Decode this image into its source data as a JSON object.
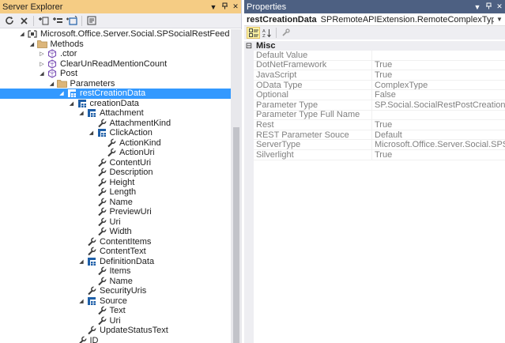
{
  "server_explorer": {
    "title": "Server Explorer",
    "tree": [
      {
        "label": "Microsoft.Office.Server.Social.SPSocialRestFeed",
        "icon": "namespace-icon",
        "depth": 2,
        "expander": "expanded"
      },
      {
        "label": "Methods",
        "icon": "folder-icon",
        "depth": 3,
        "expander": "expanded"
      },
      {
        "label": ".ctor",
        "icon": "method-icon",
        "depth": 4,
        "expander": "collapsed"
      },
      {
        "label": "ClearUnReadMentionCount",
        "icon": "method-icon",
        "depth": 4,
        "expander": "collapsed"
      },
      {
        "label": "Post",
        "icon": "method-icon",
        "depth": 4,
        "expander": "expanded"
      },
      {
        "label": "Parameters",
        "icon": "folder-icon",
        "depth": 5,
        "expander": "expanded"
      },
      {
        "label": "restCreationData",
        "icon": "complex-type-icon",
        "depth": 6,
        "expander": "expanded",
        "selected": true
      },
      {
        "label": "creationData",
        "icon": "complex-type-icon",
        "depth": 7,
        "expander": "expanded"
      },
      {
        "label": "Attachment",
        "icon": "complex-type-icon",
        "depth": 8,
        "expander": "expanded"
      },
      {
        "label": "AttachmentKind",
        "icon": "property-wrench-icon",
        "depth": 9,
        "expander": "none"
      },
      {
        "label": "ClickAction",
        "icon": "complex-type-icon",
        "depth": 9,
        "expander": "expanded"
      },
      {
        "label": "ActionKind",
        "icon": "property-wrench-icon",
        "depth": 10,
        "expander": "none"
      },
      {
        "label": "ActionUri",
        "icon": "property-wrench-icon",
        "depth": 10,
        "expander": "none"
      },
      {
        "label": "ContentUri",
        "icon": "property-wrench-icon",
        "depth": 9,
        "expander": "none"
      },
      {
        "label": "Description",
        "icon": "property-wrench-icon",
        "depth": 9,
        "expander": "none"
      },
      {
        "label": "Height",
        "icon": "property-wrench-icon",
        "depth": 9,
        "expander": "none"
      },
      {
        "label": "Length",
        "icon": "property-wrench-icon",
        "depth": 9,
        "expander": "none"
      },
      {
        "label": "Name",
        "icon": "property-wrench-icon",
        "depth": 9,
        "expander": "none"
      },
      {
        "label": "PreviewUri",
        "icon": "property-wrench-icon",
        "depth": 9,
        "expander": "none"
      },
      {
        "label": "Uri",
        "icon": "property-wrench-icon",
        "depth": 9,
        "expander": "none"
      },
      {
        "label": "Width",
        "icon": "property-wrench-icon",
        "depth": 9,
        "expander": "none"
      },
      {
        "label": "ContentItems",
        "icon": "property-wrench-icon",
        "depth": 8,
        "expander": "none"
      },
      {
        "label": "ContentText",
        "icon": "property-wrench-icon",
        "depth": 8,
        "expander": "none"
      },
      {
        "label": "DefinitionData",
        "icon": "complex-type-icon",
        "depth": 8,
        "expander": "expanded"
      },
      {
        "label": "Items",
        "icon": "property-wrench-icon",
        "depth": 9,
        "expander": "none"
      },
      {
        "label": "Name",
        "icon": "property-wrench-icon",
        "depth": 9,
        "expander": "none"
      },
      {
        "label": "SecurityUris",
        "icon": "property-wrench-icon",
        "depth": 8,
        "expander": "none"
      },
      {
        "label": "Source",
        "icon": "complex-type-icon",
        "depth": 8,
        "expander": "expanded"
      },
      {
        "label": "Text",
        "icon": "property-wrench-icon",
        "depth": 9,
        "expander": "none"
      },
      {
        "label": "Uri",
        "icon": "property-wrench-icon",
        "depth": 9,
        "expander": "none"
      },
      {
        "label": "UpdateStatusText",
        "icon": "property-wrench-icon",
        "depth": 8,
        "expander": "none"
      },
      {
        "label": "ID",
        "icon": "property-wrench-icon",
        "depth": 7,
        "expander": "none"
      }
    ]
  },
  "properties": {
    "title": "Properties",
    "object_name": "restCreationData",
    "object_type": "SPRemoteAPIExtension.RemoteComplexType",
    "category": "Misc",
    "rows": [
      {
        "name": "Default Value",
        "value": ""
      },
      {
        "name": "DotNetFramework",
        "value": "True"
      },
      {
        "name": "JavaScript",
        "value": "True"
      },
      {
        "name": "OData Type",
        "value": "ComplexType"
      },
      {
        "name": "Optional",
        "value": "False"
      },
      {
        "name": "Parameter Type",
        "value": "SP.Social.SocialRestPostCreationData"
      },
      {
        "name": "Parameter Type Full Name",
        "value": ""
      },
      {
        "name": "Rest",
        "value": "True"
      },
      {
        "name": "REST Parameter Souce",
        "value": "Default"
      },
      {
        "name": "ServerType",
        "value": "Microsoft.Office.Server.Social.SPSocialR"
      },
      {
        "name": "Silverlight",
        "value": "True"
      }
    ]
  },
  "colors": {
    "active_title": "#f5cc84",
    "inactive_title": "#4d6082",
    "selection": "#3399ff",
    "complex_type_icon": "#1e5fa8"
  }
}
